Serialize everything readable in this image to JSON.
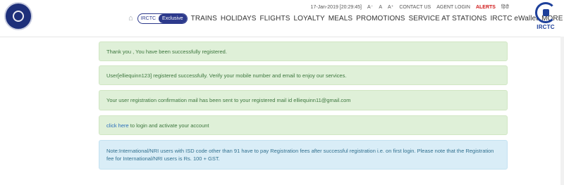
{
  "header": {
    "brand_text": "IRCTC",
    "topbar": {
      "datetime": "17-Jan-2019 [20:29:45]",
      "font_decrease": "A⁻",
      "font_normal": "A",
      "font_increase": "A⁺",
      "contact": "CONTACT US",
      "agent_login": "AGENT LOGIN",
      "alerts": "ALERTS",
      "hindi": "हिंदी"
    },
    "nav": {
      "home_icon": "home-icon",
      "exclusive_brand": "IRCTC",
      "exclusive_label": "Exclusive",
      "items": [
        "TRAINS",
        "HOLIDAYS",
        "FLIGHTS",
        "LOYALTY",
        "MEALS",
        "PROMOTIONS",
        "SERVICE AT STATIONS",
        "IRCTC eWallet",
        "MORE"
      ]
    }
  },
  "messages": {
    "thank_you": "Thank you , You have been successfully registered.",
    "registered": "User[elliequinn123] registered successfully. Verify your mobile number and email to enjoy our services.",
    "mail_sent": "Your user registration confirmation mail has been sent to your registered mail id elliequinn11@gmail.com",
    "click_here": "click here",
    "login_text": " to login and activate your account",
    "note": "Note:International/NRI users with ISD code other than 91 have to pay Registration fees after successful registration i.e. on first login. Please note that the Registration fee for International/NRI users is Rs. 100 + GST."
  },
  "colors": {
    "success_bg": "#dff0d8",
    "info_bg": "#d9edf7",
    "alert_red": "#d01a1a",
    "brand_blue": "#2d3a8c"
  }
}
